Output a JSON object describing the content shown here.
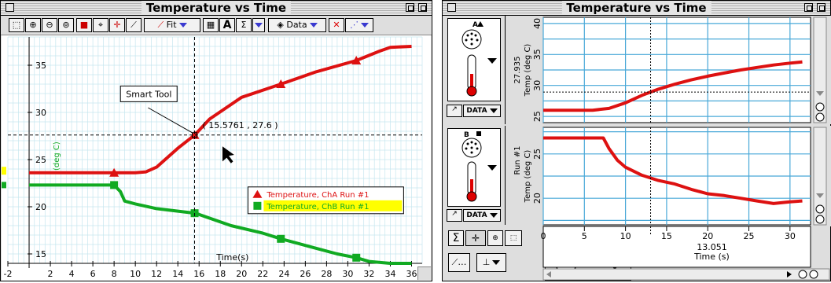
{
  "colors": {
    "cha": "#dd1111",
    "chb": "#11aa22",
    "grid": "#c6e6ef",
    "grid2": "#48a8d8",
    "legend_hl": "#ffff00"
  },
  "left_window": {
    "title": "Temperature vs Time",
    "toolbar": {
      "fit_label": "Fit",
      "data_label": "Data",
      "icons": [
        "autoscale-icon",
        "zoom-in-icon",
        "zoom-out-icon",
        "zoom-box-icon",
        "lock-icon",
        "examine-icon",
        "tangent-icon",
        "curve-fit-icon",
        "statistics-icon",
        "text-annotation-icon",
        "integral-icon",
        "data-menu-icon",
        "delete-icon",
        "graph-options-icon"
      ]
    },
    "smart_tool_label": "Smart Tool",
    "coordinate_readout": "( 15.5761 , 27.6 )",
    "x_axis_label": "Time(s)",
    "y_axis_label": "(deg C)",
    "legend": [
      "Temperature, ChA Run #1",
      "Temperature, ChB Run #1"
    ]
  },
  "right_window": {
    "title": "Temperature vs Time",
    "top_panel": {
      "channel": "A",
      "readout": "27.935",
      "ylabel": "Temp (deg C)",
      "data_button": "DATA"
    },
    "bottom_panel": {
      "channel": "B",
      "run_label": "Run #1",
      "ylabel": "Temp (deg C)",
      "data_button": "DATA"
    },
    "x_readout": "13.051",
    "x_label": "Time (s)"
  },
  "chart_data": [
    {
      "type": "line",
      "title": "Temperature vs Time",
      "xlabel": "Time(s)",
      "ylabel": "(deg C)",
      "xlim": [
        -2,
        37
      ],
      "ylim": [
        14,
        38
      ],
      "x_ticks": [
        -2,
        2,
        4,
        6,
        8,
        10,
        12,
        14,
        16,
        18,
        20,
        22,
        24,
        26,
        28,
        30,
        32,
        34,
        36
      ],
      "y_ticks": [
        15,
        20,
        25,
        30,
        35
      ],
      "grid": true,
      "legend_position": "right",
      "series": [
        {
          "name": "Temperature, ChA Run #1",
          "x": [
            0,
            4,
            8,
            10,
            11,
            12,
            13,
            14,
            15.58,
            17,
            20,
            23.7,
            27,
            30.8,
            33,
            34,
            36
          ],
          "y": [
            23.6,
            23.6,
            23.6,
            23.6,
            23.7,
            24.2,
            25.2,
            26.2,
            27.6,
            29.3,
            31.6,
            33.0,
            34.3,
            35.5,
            36.5,
            36.9,
            37.0
          ]
        },
        {
          "name": "Temperature, ChB Run #1",
          "x": [
            0,
            4,
            8,
            8.6,
            9,
            10,
            12,
            15.7,
            19,
            22,
            23.7,
            27,
            29,
            30.8,
            32,
            34,
            36
          ],
          "y": [
            22.3,
            22.3,
            22.3,
            21.6,
            20.6,
            20.3,
            19.8,
            19.3,
            18.0,
            17.2,
            16.6,
            15.6,
            15.0,
            14.6,
            14.2,
            14.0,
            14.0
          ]
        }
      ],
      "markers_x": [
        8,
        15.58,
        23.7,
        30.8
      ]
    },
    {
      "type": "line",
      "title": "",
      "xlabel": "Time (s)",
      "ylabel": "Temp (deg C)",
      "xlim": [
        0,
        32.5
      ],
      "ylim": [
        24,
        41
      ],
      "x_ticks": [
        0,
        5,
        10,
        15,
        20,
        25,
        30
      ],
      "y_ticks": [
        25,
        30,
        35,
        40
      ],
      "grid": true,
      "series": [
        {
          "name": "A",
          "x": [
            0,
            3,
            6,
            8,
            10,
            12,
            14,
            16,
            18,
            20,
            22,
            24,
            26,
            28,
            30,
            31.5
          ],
          "y": [
            26.0,
            26.0,
            26.0,
            26.3,
            27.2,
            28.4,
            29.4,
            30.2,
            30.9,
            31.5,
            32.0,
            32.5,
            32.9,
            33.3,
            33.6,
            33.8
          ]
        }
      ]
    },
    {
      "type": "line",
      "title": "",
      "xlabel": "Time (s)",
      "ylabel": "Temp (deg C)",
      "xlim": [
        0,
        32.5
      ],
      "ylim": [
        17,
        28
      ],
      "x_ticks": [
        0,
        5,
        10,
        15,
        20,
        25,
        30
      ],
      "y_ticks": [
        20,
        25
      ],
      "grid": true,
      "series": [
        {
          "name": "B",
          "x": [
            0,
            3,
            6,
            7.3,
            8,
            9,
            10,
            12,
            14,
            16,
            18,
            20,
            22,
            24,
            26,
            28,
            30,
            31.5
          ],
          "y": [
            26.8,
            26.8,
            26.8,
            26.8,
            25.6,
            24.3,
            23.5,
            22.6,
            22.0,
            21.6,
            21.0,
            20.5,
            20.3,
            20.0,
            19.7,
            19.4,
            19.6,
            19.7
          ]
        }
      ]
    }
  ]
}
